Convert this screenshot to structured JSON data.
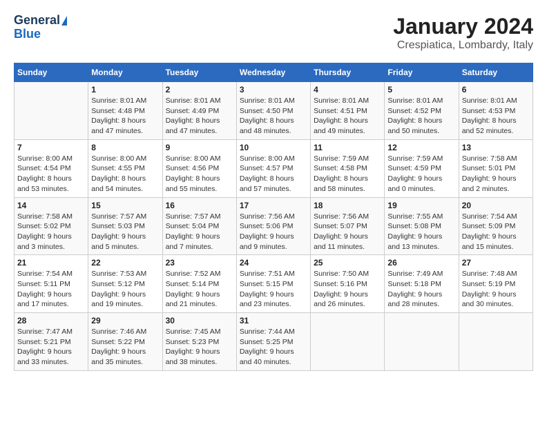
{
  "header": {
    "logo_line1": "General",
    "logo_line2": "Blue",
    "title": "January 2024",
    "subtitle": "Crespiatica, Lombardy, Italy"
  },
  "weekdays": [
    "Sunday",
    "Monday",
    "Tuesday",
    "Wednesday",
    "Thursday",
    "Friday",
    "Saturday"
  ],
  "weeks": [
    [
      {
        "day": "",
        "info": ""
      },
      {
        "day": "1",
        "info": "Sunrise: 8:01 AM\nSunset: 4:48 PM\nDaylight: 8 hours\nand 47 minutes."
      },
      {
        "day": "2",
        "info": "Sunrise: 8:01 AM\nSunset: 4:49 PM\nDaylight: 8 hours\nand 47 minutes."
      },
      {
        "day": "3",
        "info": "Sunrise: 8:01 AM\nSunset: 4:50 PM\nDaylight: 8 hours\nand 48 minutes."
      },
      {
        "day": "4",
        "info": "Sunrise: 8:01 AM\nSunset: 4:51 PM\nDaylight: 8 hours\nand 49 minutes."
      },
      {
        "day": "5",
        "info": "Sunrise: 8:01 AM\nSunset: 4:52 PM\nDaylight: 8 hours\nand 50 minutes."
      },
      {
        "day": "6",
        "info": "Sunrise: 8:01 AM\nSunset: 4:53 PM\nDaylight: 8 hours\nand 52 minutes."
      }
    ],
    [
      {
        "day": "7",
        "info": "Sunrise: 8:00 AM\nSunset: 4:54 PM\nDaylight: 8 hours\nand 53 minutes."
      },
      {
        "day": "8",
        "info": "Sunrise: 8:00 AM\nSunset: 4:55 PM\nDaylight: 8 hours\nand 54 minutes."
      },
      {
        "day": "9",
        "info": "Sunrise: 8:00 AM\nSunset: 4:56 PM\nDaylight: 8 hours\nand 55 minutes."
      },
      {
        "day": "10",
        "info": "Sunrise: 8:00 AM\nSunset: 4:57 PM\nDaylight: 8 hours\nand 57 minutes."
      },
      {
        "day": "11",
        "info": "Sunrise: 7:59 AM\nSunset: 4:58 PM\nDaylight: 8 hours\nand 58 minutes."
      },
      {
        "day": "12",
        "info": "Sunrise: 7:59 AM\nSunset: 4:59 PM\nDaylight: 9 hours\nand 0 minutes."
      },
      {
        "day": "13",
        "info": "Sunrise: 7:58 AM\nSunset: 5:01 PM\nDaylight: 9 hours\nand 2 minutes."
      }
    ],
    [
      {
        "day": "14",
        "info": "Sunrise: 7:58 AM\nSunset: 5:02 PM\nDaylight: 9 hours\nand 3 minutes."
      },
      {
        "day": "15",
        "info": "Sunrise: 7:57 AM\nSunset: 5:03 PM\nDaylight: 9 hours\nand 5 minutes."
      },
      {
        "day": "16",
        "info": "Sunrise: 7:57 AM\nSunset: 5:04 PM\nDaylight: 9 hours\nand 7 minutes."
      },
      {
        "day": "17",
        "info": "Sunrise: 7:56 AM\nSunset: 5:06 PM\nDaylight: 9 hours\nand 9 minutes."
      },
      {
        "day": "18",
        "info": "Sunrise: 7:56 AM\nSunset: 5:07 PM\nDaylight: 9 hours\nand 11 minutes."
      },
      {
        "day": "19",
        "info": "Sunrise: 7:55 AM\nSunset: 5:08 PM\nDaylight: 9 hours\nand 13 minutes."
      },
      {
        "day": "20",
        "info": "Sunrise: 7:54 AM\nSunset: 5:09 PM\nDaylight: 9 hours\nand 15 minutes."
      }
    ],
    [
      {
        "day": "21",
        "info": "Sunrise: 7:54 AM\nSunset: 5:11 PM\nDaylight: 9 hours\nand 17 minutes."
      },
      {
        "day": "22",
        "info": "Sunrise: 7:53 AM\nSunset: 5:12 PM\nDaylight: 9 hours\nand 19 minutes."
      },
      {
        "day": "23",
        "info": "Sunrise: 7:52 AM\nSunset: 5:14 PM\nDaylight: 9 hours\nand 21 minutes."
      },
      {
        "day": "24",
        "info": "Sunrise: 7:51 AM\nSunset: 5:15 PM\nDaylight: 9 hours\nand 23 minutes."
      },
      {
        "day": "25",
        "info": "Sunrise: 7:50 AM\nSunset: 5:16 PM\nDaylight: 9 hours\nand 26 minutes."
      },
      {
        "day": "26",
        "info": "Sunrise: 7:49 AM\nSunset: 5:18 PM\nDaylight: 9 hours\nand 28 minutes."
      },
      {
        "day": "27",
        "info": "Sunrise: 7:48 AM\nSunset: 5:19 PM\nDaylight: 9 hours\nand 30 minutes."
      }
    ],
    [
      {
        "day": "28",
        "info": "Sunrise: 7:47 AM\nSunset: 5:21 PM\nDaylight: 9 hours\nand 33 minutes."
      },
      {
        "day": "29",
        "info": "Sunrise: 7:46 AM\nSunset: 5:22 PM\nDaylight: 9 hours\nand 35 minutes."
      },
      {
        "day": "30",
        "info": "Sunrise: 7:45 AM\nSunset: 5:23 PM\nDaylight: 9 hours\nand 38 minutes."
      },
      {
        "day": "31",
        "info": "Sunrise: 7:44 AM\nSunset: 5:25 PM\nDaylight: 9 hours\nand 40 minutes."
      },
      {
        "day": "",
        "info": ""
      },
      {
        "day": "",
        "info": ""
      },
      {
        "day": "",
        "info": ""
      }
    ]
  ]
}
